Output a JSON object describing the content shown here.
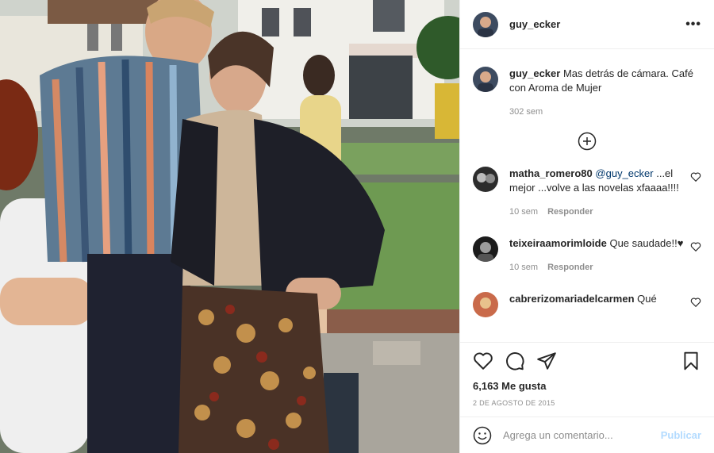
{
  "post": {
    "username": "guy_ecker",
    "more_label": "•••"
  },
  "caption": {
    "username": "guy_ecker",
    "text": "Mas detrás de cámara. Café con Aroma de Mujer",
    "time": "302 sem"
  },
  "comments": [
    {
      "username": "matha_romero80",
      "mention": "@guy_ecker",
      "text": "...el mejor ...volve a las novelas xfaaaa!!!!",
      "time": "10 sem",
      "reply_label": "Responder"
    },
    {
      "username": "teixeiraamorimloide",
      "mention": "",
      "text": "Que saudade!!♥",
      "time": "10 sem",
      "reply_label": "Responder"
    },
    {
      "username": "cabrerizomariadelcarmen",
      "mention": "",
      "text": "Qué",
      "time": "",
      "reply_label": ""
    }
  ],
  "likes": "6,163 Me gusta",
  "date": "2 DE AGOSTO DE 2015",
  "add_comment": {
    "placeholder": "Agrega un comentario...",
    "post_label": "Publicar"
  },
  "icons": {
    "more": "more-options-icon",
    "load_more": "plus-circle-icon",
    "like": "heart-icon",
    "comment": "comment-icon",
    "share": "share-icon",
    "save": "bookmark-icon",
    "emoji": "emoji-icon"
  }
}
